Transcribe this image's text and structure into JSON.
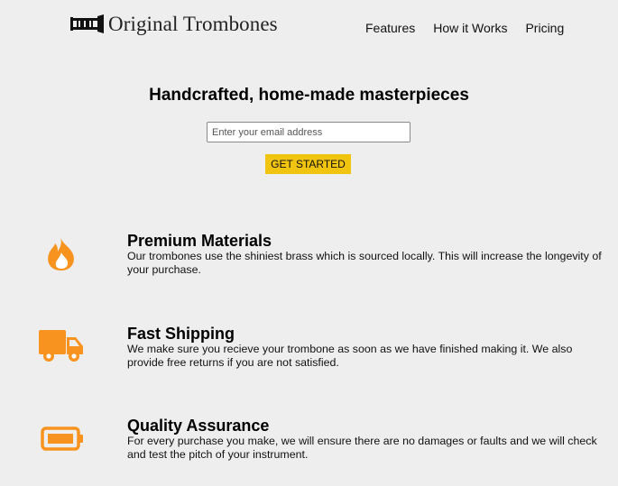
{
  "brand": {
    "name": "Original Trombones",
    "logo_icon": "trombone-logo-icon"
  },
  "nav": {
    "items": [
      {
        "label": "Features"
      },
      {
        "label": "How it Works"
      },
      {
        "label": "Pricing"
      }
    ]
  },
  "hero": {
    "title": "Handcrafted, home-made masterpieces",
    "email_placeholder": "Enter your email address",
    "cta_label": "GET STARTED"
  },
  "features": [
    {
      "icon": "fire-icon",
      "title": "Premium Materials",
      "description": "Our trombones use the shiniest brass which is sourced locally. This will increase the longevity of your purchase."
    },
    {
      "icon": "truck-icon",
      "title": "Fast Shipping",
      "description": "We make sure you recieve your trombone as soon as we have finished making it. We also provide free returns if you are not satisfied."
    },
    {
      "icon": "battery-icon",
      "title": "Quality Assurance",
      "description": "For every purchase you make, we will ensure there are no damages or faults and we will check and test the pitch of your instrument."
    }
  ],
  "colors": {
    "background": "#eeeeee",
    "accent_orange": "#f7931e",
    "cta_yellow": "#f1c40f"
  }
}
